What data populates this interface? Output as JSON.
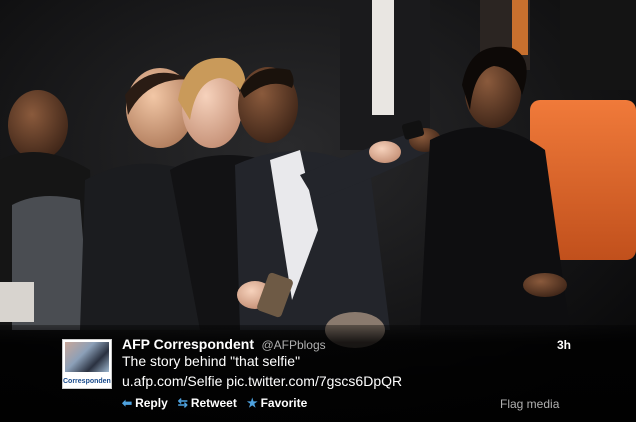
{
  "tweet": {
    "author_name": "AFP Correspondent",
    "author_handle": "@AFPblogs",
    "timestamp": "3h",
    "text": "The story behind \"that selfie\"",
    "link_1": "u.afp.com/Selfie",
    "link_2": "pic.twitter.com/7gscs6DpQR",
    "avatar_label": "Correspondent"
  },
  "actions": {
    "reply": "Reply",
    "retweet": "Retweet",
    "favorite": "Favorite",
    "flag": "Flag media"
  },
  "icons": {
    "reply": "reply-arrow-icon",
    "retweet": "retweet-icon",
    "favorite": "star-icon"
  },
  "colors": {
    "action_icon": "#4fa3e0",
    "overlay": "#000000",
    "seat_orange": "#e8692e"
  }
}
